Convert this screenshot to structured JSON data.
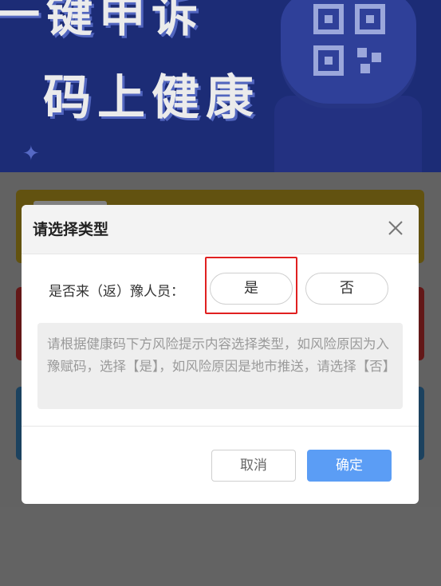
{
  "banner": {
    "line1": "一键申诉",
    "line2": "码上健康",
    "qr_icon": "qr-code-icon",
    "spark_icon": "sparkle-icon"
  },
  "dialog": {
    "title": "请选择类型",
    "close_icon": "close-icon",
    "question": "是否来（返）豫人员：",
    "options": [
      "是",
      "否"
    ],
    "selected_highlight": "是",
    "hint": "请根据健康码下方风险提示内容选择类型，如风险原因为入豫赋码，选择【是】，如风险原因是地市推送，请选择【否】",
    "cancel_label": "取消",
    "confirm_label": "确定"
  },
  "colors": {
    "banner_bg": "#1f3081",
    "highlight_border": "#e02020",
    "confirm_bg": "#5b9df5"
  }
}
